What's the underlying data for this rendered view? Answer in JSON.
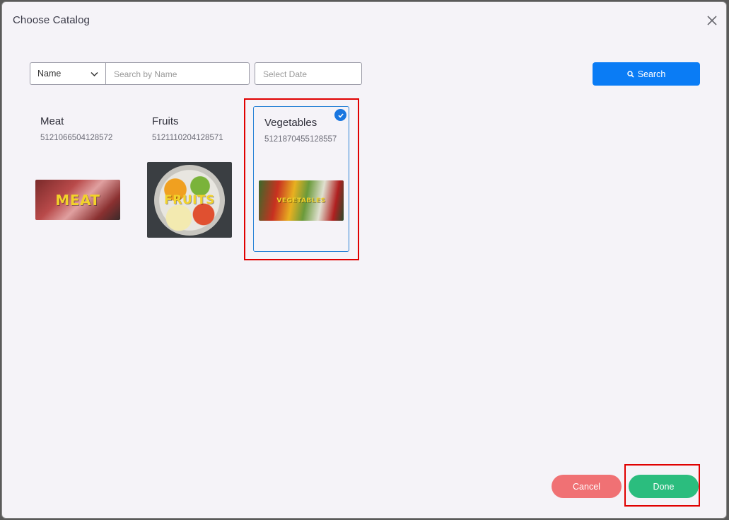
{
  "dialog": {
    "title": "Choose Catalog"
  },
  "filters": {
    "field_select": "Name",
    "search_placeholder": "Search by Name",
    "date_placeholder": "Select Date",
    "search_button": "Search"
  },
  "catalogs": [
    {
      "name": "Meat",
      "code": "5121066504128572",
      "image_text": "MEAT",
      "selected": false,
      "icon": "meat-image"
    },
    {
      "name": "Fruits",
      "code": "5121110204128571",
      "image_text": "FRUITS",
      "selected": false,
      "icon": "fruits-image"
    },
    {
      "name": "Vegetables",
      "code": "5121870455128557",
      "image_text": "VEGETABLES",
      "selected": true,
      "icon": "vegetables-image"
    }
  ],
  "footer": {
    "cancel_label": "Cancel",
    "done_label": "Done"
  },
  "colors": {
    "primary": "#0a7cf5",
    "cancel": "#f07174",
    "done": "#2bbd7e",
    "selected_border": "#2a83d6",
    "highlight": "#e00000"
  }
}
